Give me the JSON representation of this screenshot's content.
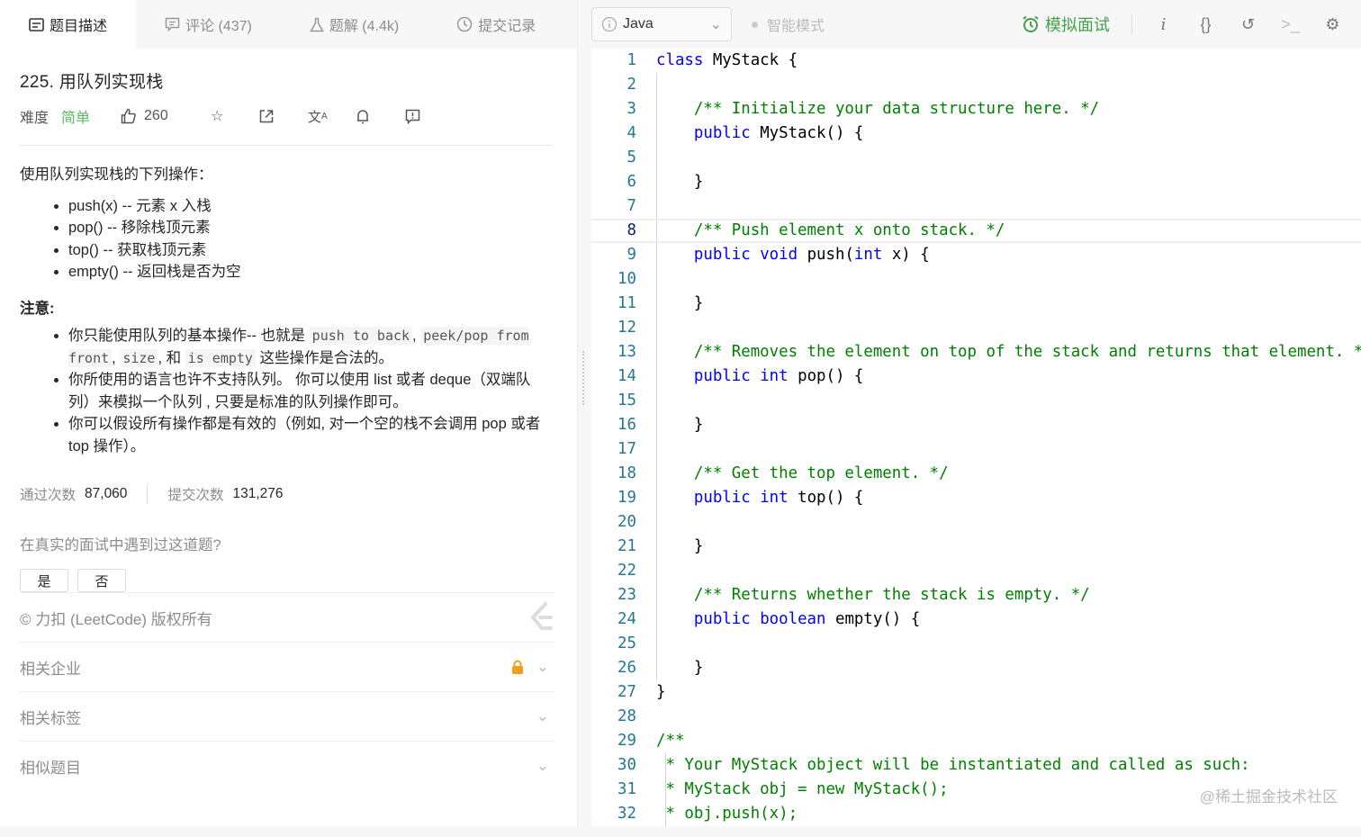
{
  "tabs": [
    {
      "label": "题目描述",
      "icon": "description-icon"
    },
    {
      "label": "评论 (437)",
      "icon": "comment-icon"
    },
    {
      "label": "题解 (4.4k)",
      "icon": "flask-icon"
    },
    {
      "label": "提交记录",
      "icon": "clock-icon"
    }
  ],
  "problem": {
    "title": "225. 用队列实现栈",
    "difficulty_label": "难度",
    "difficulty": "简单",
    "likes": "260",
    "intro": "使用队列实现栈的下列操作：",
    "ops": [
      "push(x) -- 元素 x 入栈",
      "pop() -- 移除栈顶元素",
      "top() -- 获取栈顶元素",
      "empty() -- 返回栈是否为空"
    ],
    "note_title": "注意:",
    "notes": {
      "n1a": "你只能使用队列的基本操作-- 也就是 ",
      "c1": "push to back",
      "sep1": ", ",
      "c2": "peek/pop from front",
      "sep2": ", ",
      "c3": "size",
      "n1b": ", 和 ",
      "c4": "is empty",
      "n1c": " 这些操作是合法的。",
      "n2": "你所使用的语言也许不支持队列。 你可以使用 list 或者 deque（双端队列）来模拟一个队列 , 只要是标准的队列操作即可。",
      "n3": "你可以假设所有操作都是有效的（例如, 对一个空的栈不会调用 pop 或者 top 操作）。"
    },
    "stats": {
      "accepted_label": "通过次数",
      "accepted": "87,060",
      "submitted_label": "提交次数",
      "submitted": "131,276"
    },
    "question": "在真实的面试中遇到过这道题?",
    "yes": "是",
    "no": "否",
    "copyright": "© 力扣 (LeetCode) 版权所有",
    "sections": [
      "相关企业",
      "相关标签",
      "相似题目"
    ]
  },
  "editor": {
    "language": "Java",
    "smart_mode": "智能模式",
    "mock_interview": "模拟面试",
    "lines": [
      [
        [
          "k",
          "class"
        ],
        [
          "t",
          " MyStack {"
        ]
      ],
      [],
      [
        [
          "t",
          "    "
        ],
        [
          "c",
          "/** Initialize your data structure here. */"
        ]
      ],
      [
        [
          "t",
          "    "
        ],
        [
          "k",
          "public"
        ],
        [
          "t",
          " MyStack() {"
        ]
      ],
      [],
      [
        [
          "t",
          "    }"
        ]
      ],
      [],
      [
        [
          "t",
          "    "
        ],
        [
          "c",
          "/** Push element x onto stack. */"
        ]
      ],
      [
        [
          "t",
          "    "
        ],
        [
          "k",
          "public"
        ],
        [
          "t",
          " "
        ],
        [
          "k",
          "void"
        ],
        [
          "t",
          " push("
        ],
        [
          "k",
          "int"
        ],
        [
          "t",
          " x) {"
        ]
      ],
      [],
      [
        [
          "t",
          "    }"
        ]
      ],
      [],
      [
        [
          "t",
          "    "
        ],
        [
          "c",
          "/** Removes the element on top of the stack and returns that element. */"
        ]
      ],
      [
        [
          "t",
          "    "
        ],
        [
          "k",
          "public"
        ],
        [
          "t",
          " "
        ],
        [
          "k",
          "int"
        ],
        [
          "t",
          " pop() {"
        ]
      ],
      [],
      [
        [
          "t",
          "    }"
        ]
      ],
      [],
      [
        [
          "t",
          "    "
        ],
        [
          "c",
          "/** Get the top element. */"
        ]
      ],
      [
        [
          "t",
          "    "
        ],
        [
          "k",
          "public"
        ],
        [
          "t",
          " "
        ],
        [
          "k",
          "int"
        ],
        [
          "t",
          " top() {"
        ]
      ],
      [],
      [
        [
          "t",
          "    }"
        ]
      ],
      [],
      [
        [
          "t",
          "    "
        ],
        [
          "c",
          "/** Returns whether the stack is empty. */"
        ]
      ],
      [
        [
          "t",
          "    "
        ],
        [
          "k",
          "public"
        ],
        [
          "t",
          " "
        ],
        [
          "k",
          "boolean"
        ],
        [
          "t",
          " empty() {"
        ]
      ],
      [],
      [
        [
          "t",
          "    }"
        ]
      ],
      [
        [
          "t",
          "}"
        ]
      ],
      [],
      [
        [
          "c",
          "/**"
        ]
      ],
      [
        [
          "c",
          " * Your MyStack object will be instantiated and called as such:"
        ]
      ],
      [
        [
          "c",
          " * MyStack obj = new MyStack();"
        ]
      ],
      [
        [
          "c",
          " * obj.push(x);"
        ]
      ]
    ],
    "current_line": 8
  },
  "watermark": "@稀土掘金技术社区",
  "colors": {
    "accent": "#43a047",
    "easy": "#5cb85c",
    "keyword": "#0000ff",
    "comment": "#008000",
    "line_number": "#237893"
  }
}
